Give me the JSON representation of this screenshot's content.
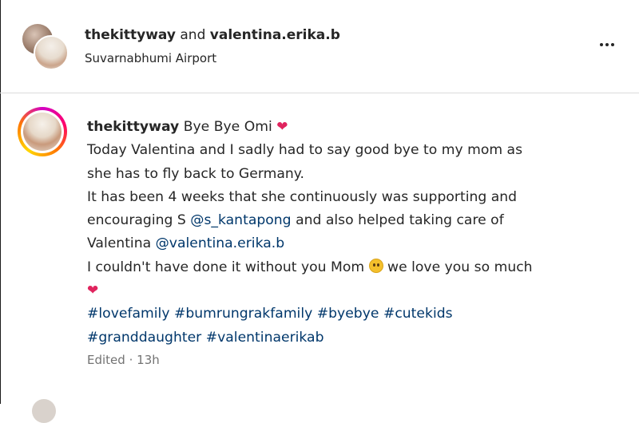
{
  "header": {
    "user1": "thekittyway",
    "and_text": "and",
    "user2": "valentina.erika.b",
    "location": "Suvarnabhumi Airport",
    "more_icon": "more-horizontal-icon"
  },
  "caption": {
    "username": "thekittyway",
    "line1_text": "Bye Bye Omi",
    "line2": "Today Valentina and I sadly had to say good bye to my mom as",
    "line3": "she has to fly back to Germany.",
    "line4": "It has been 4 weeks that she continuously was supporting and",
    "line5_pre": "encouraging S",
    "mention1": "@s_kantapong",
    "line5_post": "and also helped taking care of",
    "line6_pre": "Valentina",
    "mention2": "@valentina.erika.b",
    "line7_pre": "I couldn't have done it without you Mom",
    "line7_post": "we love you so much",
    "hashtags_line1": [
      "#lovefamily",
      "#bumrungrakfamily",
      "#byebye",
      "#cutekids"
    ],
    "hashtags_line2": [
      "#granddaughter",
      "#valentinaerikab"
    ],
    "edited": "Edited",
    "separator": "·",
    "time": "13h",
    "heart_icon": "red-heart-icon",
    "emoji_icon": "pleading-face-emoji-icon",
    "heart_color": "#e0245e",
    "link_color": "#00376b"
  }
}
